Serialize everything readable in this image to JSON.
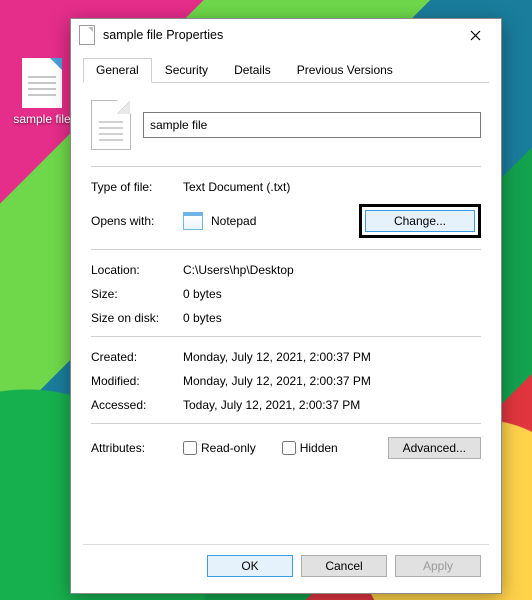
{
  "desktop": {
    "file_label": "sample file"
  },
  "dialog": {
    "title": "sample file Properties",
    "tabs": [
      "General",
      "Security",
      "Details",
      "Previous Versions"
    ],
    "active_tab": 0,
    "filename": "sample file",
    "rows": {
      "type_of_file_label": "Type of file:",
      "type_of_file_value": "Text Document (.txt)",
      "opens_with_label": "Opens with:",
      "opens_with_value": "Notepad",
      "change_button": "Change...",
      "location_label": "Location:",
      "location_value": "C:\\Users\\hp\\Desktop",
      "size_label": "Size:",
      "size_value": "0 bytes",
      "size_on_disk_label": "Size on disk:",
      "size_on_disk_value": "0 bytes",
      "created_label": "Created:",
      "created_value": "Monday, July 12, 2021, 2:00:37 PM",
      "modified_label": "Modified:",
      "modified_value": "Monday, July 12, 2021, 2:00:37 PM",
      "accessed_label": "Accessed:",
      "accessed_value": "Today, July 12, 2021, 2:00:37 PM",
      "attributes_label": "Attributes:",
      "readonly_label": "Read-only",
      "hidden_label": "Hidden",
      "advanced_button": "Advanced..."
    },
    "footer": {
      "ok": "OK",
      "cancel": "Cancel",
      "apply": "Apply"
    }
  }
}
